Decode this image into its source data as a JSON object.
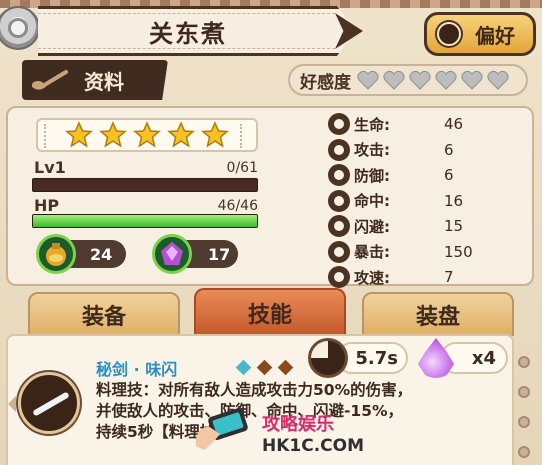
{
  "header": {
    "title": "关东煮",
    "favorite_label": "偏好"
  },
  "info_tab": {
    "label": "资料"
  },
  "affection": {
    "label": "好感度",
    "hearts_total": 6,
    "hearts_filled": 0
  },
  "character": {
    "stars": 5,
    "level_label": "Lv1",
    "exp_text": "0/61",
    "exp_fraction": 0.0,
    "hp_label": "HP",
    "hp_text": "46/46",
    "hp_fraction": 1.0,
    "items": [
      {
        "icon": "potion-icon",
        "count": "24"
      },
      {
        "icon": "purple-gem-icon",
        "count": "17"
      }
    ]
  },
  "stats": [
    {
      "icon": "heart-stat-icon",
      "label": "生命:",
      "value": "46"
    },
    {
      "icon": "attack-stat-icon",
      "label": "攻击:",
      "value": "6"
    },
    {
      "icon": "shield-stat-icon",
      "label": "防御:",
      "value": "6"
    },
    {
      "icon": "crosshair-stat-icon",
      "label": "命中:",
      "value": "16"
    },
    {
      "icon": "dodge-stat-icon",
      "label": "闪避:",
      "value": "15"
    },
    {
      "icon": "critical-stat-icon",
      "label": "暴击:",
      "value": "150"
    },
    {
      "icon": "speed-stat-icon",
      "label": "攻速:",
      "value": "7"
    }
  ],
  "tabs": [
    {
      "label": "装备",
      "active": false
    },
    {
      "label": "技能",
      "active": true
    },
    {
      "label": "装盘",
      "active": false
    }
  ],
  "skill": {
    "name": "秘剑 · 味闪",
    "cooldown": "5.7s",
    "cost": "x4",
    "description": "料理技：对所有敌人造成攻击力50%的伤害，并使敌人的攻击、防御、命中、闪避-15%，持续5秒【料理技】",
    "description_visible_lines": [
      "料理技：对所有敌人造成攻击力50%的伤害，",
      "并使敌人的攻击、防御、命中、闪避-15%，",
      "持续5秒【料理技】"
    ]
  },
  "watermark": {
    "line1": "攻略娱乐",
    "line2": "HK1C.COM"
  },
  "colors": {
    "accent_brown": "#4a3323",
    "hp_green": "#3cba2a",
    "active_tab": "#c5562c",
    "skill_name": "#2a8fc4",
    "star_gold": "#f6c323"
  }
}
